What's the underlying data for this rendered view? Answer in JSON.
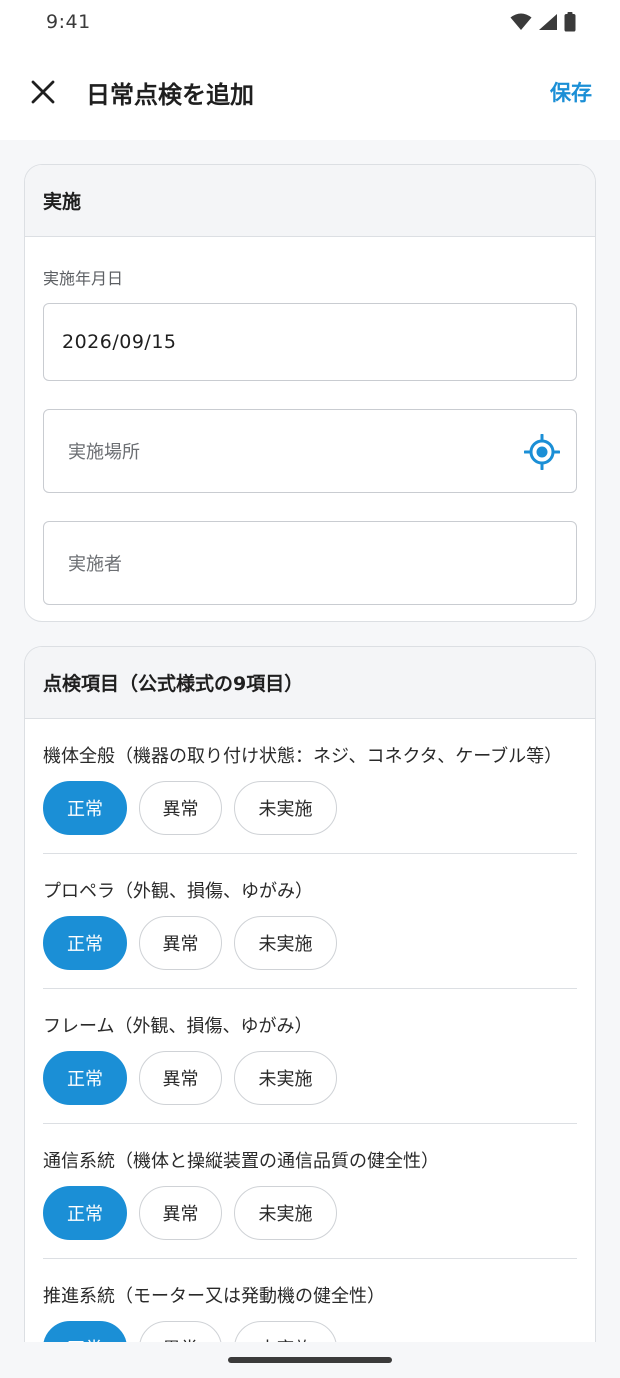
{
  "status_bar": {
    "time": "9:41"
  },
  "app_bar": {
    "title": "日常点検を追加",
    "save_label": "保存"
  },
  "implementation": {
    "header": "実施",
    "date_label": "実施年月日",
    "date_value": "2026/09/15",
    "location_placeholder": "実施場所",
    "performer_placeholder": "実施者"
  },
  "inspection": {
    "header": "点検項目（公式様式の9項目）",
    "options": [
      "正常",
      "異常",
      "未実施"
    ],
    "items": [
      {
        "label": "機体全般（機器の取り付け状態：ネジ、コネクタ、ケーブル等）",
        "selected": "正常"
      },
      {
        "label": "プロペラ（外観、損傷、ゆがみ）",
        "selected": "正常"
      },
      {
        "label": "フレーム（外観、損傷、ゆがみ）",
        "selected": "正常"
      },
      {
        "label": "通信系統（機体と操縦装置の通信品質の健全性）",
        "selected": "正常"
      },
      {
        "label": "推進系統（モーター又は発動機の健全性）",
        "selected": "正常"
      }
    ]
  },
  "colors": {
    "accent": "#1b8fd6"
  }
}
